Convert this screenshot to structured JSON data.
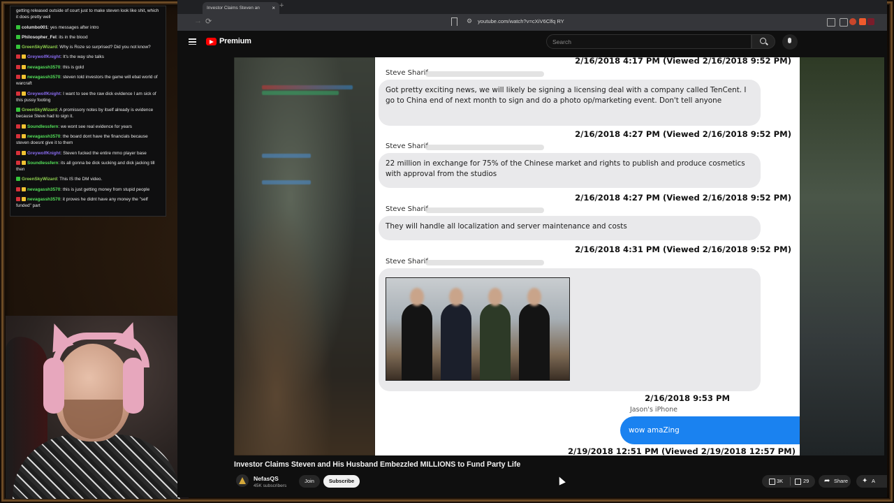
{
  "chat": {
    "messages": [
      {
        "user": "",
        "color": "#e8e8e8",
        "badges": [],
        "text": "getting released outside of court just to make steven look like shit, which it does pretty well"
      },
      {
        "user": "columbo001",
        "color": "#e8e8e8",
        "badges": [
          "k"
        ],
        "text": "yes messages after intro"
      },
      {
        "user": "Philosopher_Fel",
        "color": "#e8e8e8",
        "badges": [
          "k"
        ],
        "text": "its in the blood"
      },
      {
        "user": "GreenSkyWizard",
        "color": "#8fd14f",
        "badges": [
          "k"
        ],
        "text": "Why is Roze so surprised? Did you not know?"
      },
      {
        "user": "GreywolfKnight",
        "color": "#8a6cf0",
        "badges": [
          "r",
          "y"
        ],
        "text": "It's the way she talks"
      },
      {
        "user": "nevagassh3570",
        "color": "#54e05a",
        "badges": [
          "r",
          "y"
        ],
        "text": "this is gold"
      },
      {
        "user": "nevagassh3570",
        "color": "#54e05a",
        "badges": [
          "r",
          "y"
        ],
        "text": "steven told investors the game will ebat world of warcraft"
      },
      {
        "user": "GreywolfKnight",
        "color": "#8a6cf0",
        "badges": [
          "r",
          "y"
        ],
        "text": "I want to see the raw dick evidence I am sick of this pussy footing"
      },
      {
        "user": "GreenSkyWizard",
        "color": "#8fd14f",
        "badges": [
          "k"
        ],
        "text": "A promissory notes by itself already is evidence because Steve had to sign it."
      },
      {
        "user": "Soundlessfern",
        "color": "#54e05a",
        "badges": [
          "r",
          "y"
        ],
        "text": "we wont see real evidence for years"
      },
      {
        "user": "nevagassh3570",
        "color": "#54e05a",
        "badges": [
          "r",
          "y"
        ],
        "text": "the board dont have the financials because steven doesnt give it to them"
      },
      {
        "user": "GreywolfKnight",
        "color": "#8a6cf0",
        "badges": [
          "r",
          "y"
        ],
        "text": "Steven fucked the entire mmo player base"
      },
      {
        "user": "Soundlessfern",
        "color": "#54e05a",
        "badges": [
          "r",
          "y"
        ],
        "text": "its all gonna be dick sucking and dick jacking till then"
      },
      {
        "user": "GreenSkyWizard",
        "color": "#8fd14f",
        "badges": [
          "k"
        ],
        "text": "This IS the DM video."
      },
      {
        "user": "nevagassh3570",
        "color": "#54e05a",
        "badges": [
          "r",
          "y"
        ],
        "text": "this is just getting money from stupid people"
      },
      {
        "user": "nevagassh3570",
        "color": "#54e05a",
        "badges": [
          "r",
          "y"
        ],
        "text": "it proves he didnt have any money the \"self funded\" part"
      }
    ]
  },
  "browser": {
    "tab_title": "Investor Claims Steven an",
    "tab_close": "×",
    "new_tab": "+",
    "url": "youtube.com/watch?v=cXiV6Clfq RY",
    "back": "←",
    "forward": "→",
    "reload": "⟳"
  },
  "youtube": {
    "brand": "Premium",
    "search_placeholder": "Search",
    "video_title": "Investor Claims Steven and His Husband Embezzled MILLIONS to Fund Party Life",
    "channel_name": "NefasQS",
    "channel_subs": "45K subscribers",
    "join_label": "Join",
    "subscribe_label": "Subscribe",
    "like_count": "3K",
    "dislike_count": "29",
    "share_label": "Share",
    "share_icon": "➦",
    "more_icon": "✦",
    "more_label": "A"
  },
  "messages": {
    "ts1": "2/16/2018 4:17 PM (Viewed 2/16/2018 9:52 PM)",
    "sender1": "Steve Sharif",
    "msg1": "Got pretty exciting news, we will likely be signing a licensing deal with a company called TenCent. I go to China end of next month to sign and do a photo op/marketing event. Don't tell anyone",
    "ts2": "2/16/2018 4:27 PM (Viewed 2/16/2018 9:52 PM)",
    "sender2": "Steve Sharif",
    "msg2": "22 million in exchange for 75% of the Chinese market and rights to publish and produce cosmetics with approval from the studios",
    "ts3": "2/16/2018 4:27 PM (Viewed 2/16/2018 9:52 PM)",
    "sender3": "Steve Sharif",
    "msg3": "They will handle all localization and server maintenance and costs",
    "ts4": "2/16/2018 4:31 PM (Viewed 2/16/2018 9:52 PM)",
    "sender4": "Steve Sharif",
    "ts5": "2/16/2018 9:53 PM",
    "me_name": "Jason's iPhone",
    "me_msg": "wow amaZing",
    "ts6": "2/19/2018 12:51 PM (Viewed 2/19/2018 12:57 PM)"
  }
}
